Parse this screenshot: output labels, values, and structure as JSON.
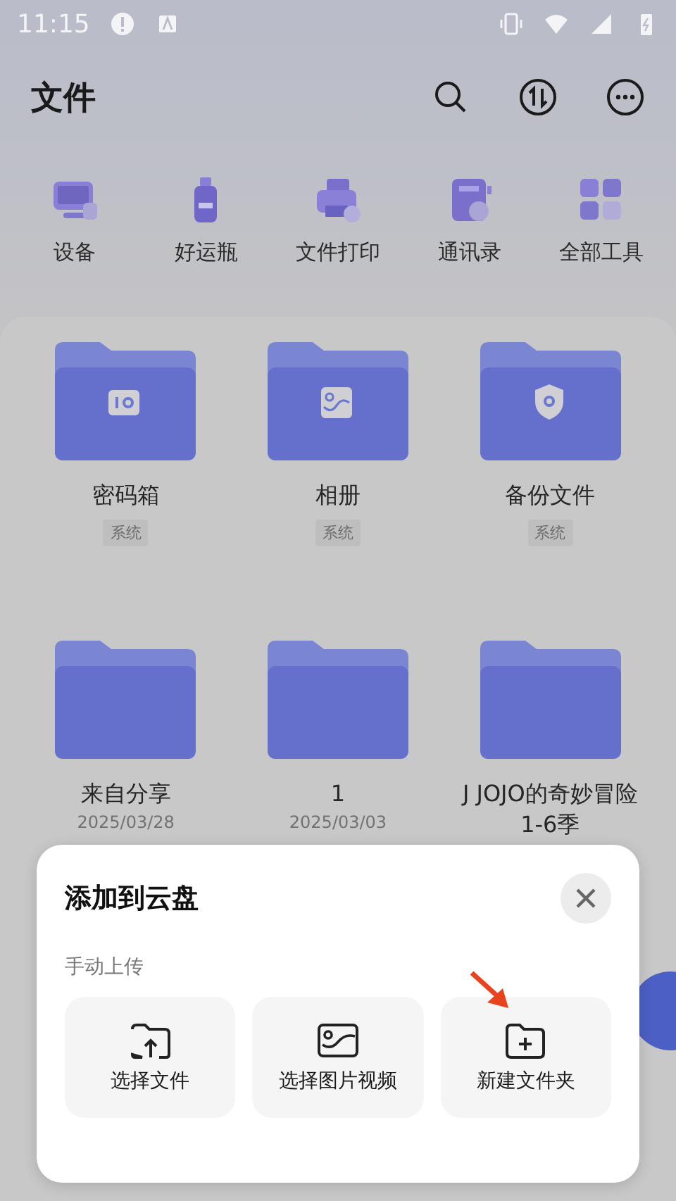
{
  "status_bar": {
    "time": "11:15"
  },
  "header": {
    "title": "文件"
  },
  "tools": [
    {
      "label": "设备",
      "kind": "device"
    },
    {
      "label": "好运瓶",
      "kind": "bottle"
    },
    {
      "label": "文件打印",
      "kind": "printer"
    },
    {
      "label": "通讯录",
      "kind": "contacts"
    },
    {
      "label": "全部工具",
      "kind": "grid"
    }
  ],
  "folders": [
    {
      "name": "密码箱",
      "tag": "系统",
      "kind": "safe"
    },
    {
      "name": "相册",
      "tag": "系统",
      "kind": "photo"
    },
    {
      "name": "备份文件",
      "tag": "系统",
      "kind": "shield"
    },
    {
      "name": "来自分享",
      "date": "2025/03/28",
      "kind": "plain"
    },
    {
      "name": "1",
      "date": "2025/03/03",
      "kind": "plain"
    },
    {
      "name": "J JOJO的奇妙冒险 1-6季",
      "kind": "plain"
    }
  ],
  "sheet": {
    "title": "添加到云盘",
    "section": "手动上传",
    "actions": [
      {
        "label": "选择文件",
        "kind": "upload"
      },
      {
        "label": "选择图片视频",
        "kind": "image"
      },
      {
        "label": "新建文件夹",
        "kind": "new-folder"
      }
    ]
  }
}
